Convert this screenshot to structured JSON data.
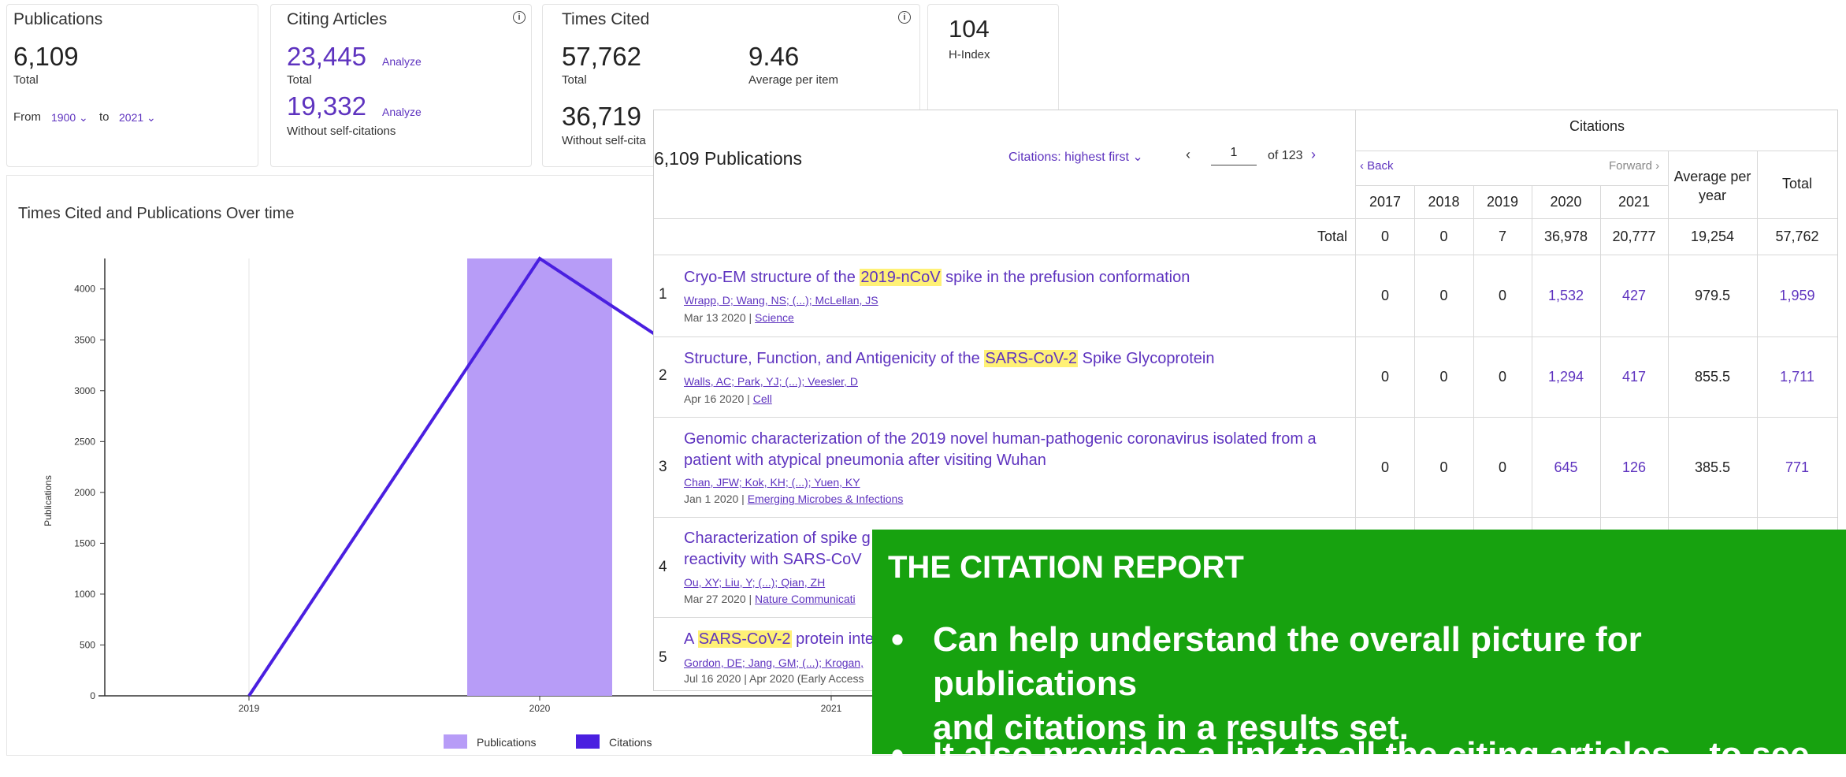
{
  "summary": {
    "publications": {
      "label": "Publications",
      "value": "6,109",
      "sub": "Total"
    },
    "range": {
      "from_label": "From",
      "from_value": "1900",
      "to_label": "to",
      "to_value": "2021"
    },
    "citing": {
      "label": "Citing Articles",
      "total_value": "23,445",
      "total_sub": "Total",
      "without_value": "19,332",
      "without_sub": "Without self-citations",
      "analyze": "Analyze"
    },
    "times_cited": {
      "label": "Times Cited",
      "total_value": "57,762",
      "total_sub": "Total",
      "avg_value": "9.46",
      "avg_sub": "Average per item",
      "without_value": "36,719",
      "without_sub": "Without self-cita"
    },
    "hindex": {
      "value": "104",
      "label": "H-Index"
    }
  },
  "chart_section": {
    "title": "Times Cited and Publications Over time"
  },
  "chart_data": {
    "type": "bar",
    "ylabel": "Publications",
    "categories": [
      "2019",
      "2020",
      "2021"
    ],
    "ylim": [
      0,
      4300
    ],
    "yticks": [
      0,
      500,
      1000,
      1500,
      2000,
      2500,
      3000,
      3500,
      4000
    ],
    "series": [
      {
        "name": "Publications",
        "type": "bar",
        "color": "#b79cf7",
        "values": [
          0,
          4300,
          null
        ]
      },
      {
        "name": "Citations",
        "type": "line",
        "color": "#4a1fe0",
        "values": [
          0,
          4300,
          null
        ]
      }
    ]
  },
  "table": {
    "heading": "6,109 Publications",
    "sort": "Citations: highest first",
    "page": "1",
    "page_of": "of 123",
    "citations_header": "Citations",
    "back": "Back",
    "forward": "Forward",
    "years": [
      "2017",
      "2018",
      "2019",
      "2020",
      "2021"
    ],
    "avg_header": "Average per year",
    "total_header": "Total",
    "total_row": {
      "label": "Total",
      "values": [
        "0",
        "0",
        "7",
        "36,978",
        "20,777",
        "19,254",
        "57,762"
      ]
    },
    "rows": [
      {
        "num": "1",
        "title_pre": "Cryo-EM structure of the ",
        "title_hl": "2019-nCoV",
        "title_post": " spike in the prefusion conformation",
        "authors": "Wrapp, D; Wang, NS; (...); McLellan, JS",
        "date": "Mar 13 2020 | ",
        "journal": "Science",
        "values": [
          "0",
          "0",
          "0",
          "1,532",
          "427",
          "979.5",
          "1,959"
        ]
      },
      {
        "num": "2",
        "title_pre": "Structure, Function, and Antigenicity of the ",
        "title_hl": "SARS-CoV-2",
        "title_post": " Spike Glycoprotein",
        "authors": "Walls, AC; Park, YJ; (...); Veesler, D",
        "date": "Apr 16 2020 | ",
        "journal": "Cell",
        "values": [
          "0",
          "0",
          "0",
          "1,294",
          "417",
          "855.5",
          "1,711"
        ]
      },
      {
        "num": "3",
        "title_line1": "Genomic characterization of the 2019 novel human-pathogenic coronavirus isolated from a",
        "title_line2": "patient with atypical pneumonia after visiting Wuhan",
        "authors": "Chan, JFW; Kok, KH; (...); Yuen, KY",
        "date": "Jan 1 2020 | ",
        "journal": "Emerging Microbes & Infections",
        "values": [
          "0",
          "0",
          "0",
          "645",
          "126",
          "385.5",
          "771"
        ]
      },
      {
        "num": "4",
        "title_line1": "Characterization of spike g",
        "title_line2": "reactivity with SARS-CoV",
        "authors": "Ou, XY; Liu, Y; (...); Qian, ZH",
        "date": "Mar 27 2020 | ",
        "journal": "Nature Communicati"
      },
      {
        "num": "5",
        "title_pre": "A ",
        "title_hl": "SARS-CoV-2",
        "title_post": " protein intera",
        "authors": "Gordon, DE; Jang, GM; (...); Krogan,",
        "date": "Jul 16 2020 | Apr 2020 (Early Access"
      }
    ]
  },
  "callout": {
    "title": "THE CITATION REPORT",
    "bullet1_line1": "Can help understand the overall picture for publications",
    "bullet1_line2": "and citations in a results set.",
    "bullet2": "It also provides a link to all the citing articles – to see",
    "bullet_glyph": "•"
  }
}
